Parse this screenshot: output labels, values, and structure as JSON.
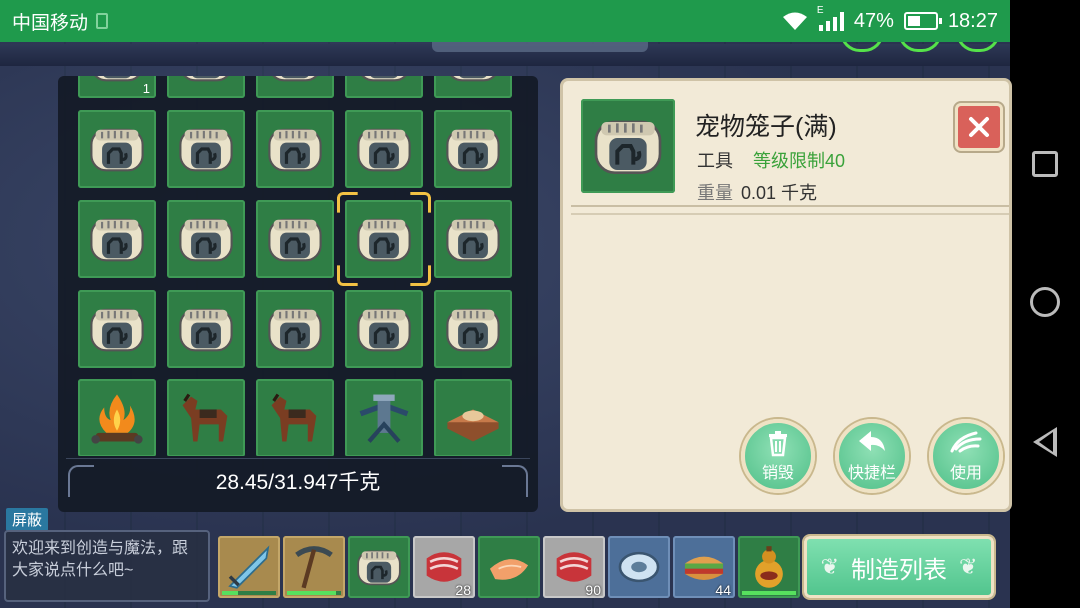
{
  "status_bar": {
    "carrier": "中国移动",
    "network_type": "E",
    "battery": "47%",
    "battery_level": 0.47,
    "time": "18:27"
  },
  "inventory": {
    "top_row_partial_count": "1",
    "weight_text": "28.45/31.947千克",
    "slots": [
      {
        "row": 1,
        "col": 1,
        "item": "pet-cage-icon"
      },
      {
        "row": 1,
        "col": 2,
        "item": "pet-cage-icon"
      },
      {
        "row": 1,
        "col": 3,
        "item": "pet-cage-icon"
      },
      {
        "row": 1,
        "col": 4,
        "item": "pet-cage-icon"
      },
      {
        "row": 1,
        "col": 5,
        "item": "pet-cage-icon"
      },
      {
        "row": 2,
        "col": 1,
        "item": "pet-cage-icon"
      },
      {
        "row": 2,
        "col": 2,
        "item": "pet-cage-icon"
      },
      {
        "row": 2,
        "col": 3,
        "item": "pet-cage-icon"
      },
      {
        "row": 2,
        "col": 4,
        "item": "pet-cage-icon",
        "selected": true
      },
      {
        "row": 2,
        "col": 5,
        "item": "pet-cage-icon"
      },
      {
        "row": 3,
        "col": 1,
        "item": "pet-cage-icon"
      },
      {
        "row": 3,
        "col": 2,
        "item": "pet-cage-icon"
      },
      {
        "row": 3,
        "col": 3,
        "item": "pet-cage-icon"
      },
      {
        "row": 3,
        "col": 4,
        "item": "pet-cage-icon"
      },
      {
        "row": 3,
        "col": 5,
        "item": "pet-cage-icon"
      },
      {
        "row": 4,
        "col": 1,
        "item": "campfire-icon"
      },
      {
        "row": 4,
        "col": 2,
        "item": "horse-icon"
      },
      {
        "row": 4,
        "col": 3,
        "item": "horse-icon"
      },
      {
        "row": 4,
        "col": 4,
        "item": "crossbow-turret-icon"
      },
      {
        "row": 4,
        "col": 5,
        "item": "wooden-platform-icon"
      }
    ]
  },
  "detail": {
    "name": "宠物笼子(满)",
    "type": "工具",
    "level_requirement": "等级限制40",
    "weight_label": "重量",
    "weight_value": "0.01 千克",
    "actions": {
      "destroy": "销毁",
      "quickbar": "快捷栏",
      "use": "使用"
    }
  },
  "chat": {
    "shield_label": "屏蔽",
    "placeholder": "欢迎来到创造与魔法，跟大家说点什么吧~"
  },
  "hotbar": {
    "slots": [
      {
        "item": "ice-sword-icon",
        "durability": 0.3
      },
      {
        "item": "pickaxe-icon",
        "durability": 0.9
      },
      {
        "item": "pet-cage-icon"
      },
      {
        "item": "raw-meat-icon",
        "count": "28"
      },
      {
        "item": "fish-fillet-icon"
      },
      {
        "item": "raw-meat-icon",
        "count": "90"
      },
      {
        "item": "stone-disc-icon"
      },
      {
        "item": "sandwich-icon",
        "count": "44"
      },
      {
        "item": "gourd-icon",
        "durability": 1.0
      }
    ],
    "craft_label": "制造列表"
  },
  "colors": {
    "status_green": "#1f9a4c",
    "slot_green": "#2f7e45",
    "level_text": "#3aa23a",
    "action_green": "#52c58e",
    "close_red": "#d9615a",
    "panel_cream": "#f2ead7"
  }
}
